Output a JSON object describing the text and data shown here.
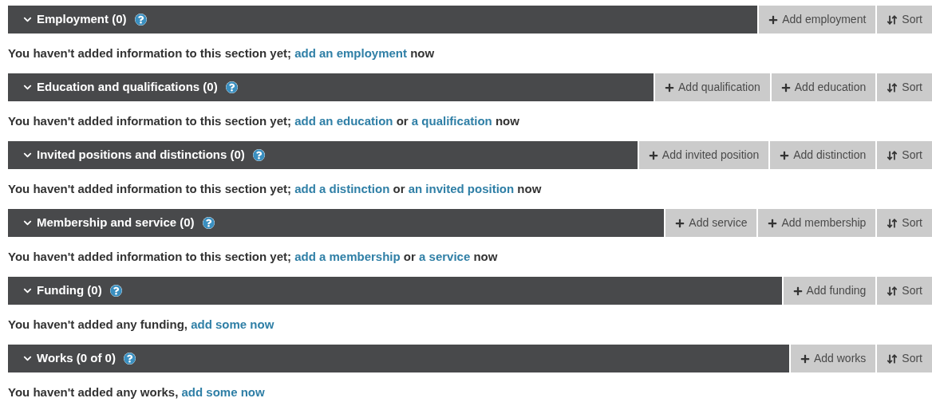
{
  "sections": [
    {
      "title": "Employment (0)",
      "expanded": true,
      "buttons": [
        {
          "kind": "add",
          "label": "Add employment"
        },
        {
          "kind": "sort",
          "label": "Sort"
        }
      ],
      "message": [
        {
          "text": "You haven't added information to this section yet; ",
          "link": false
        },
        {
          "text": "add an employment",
          "link": true
        },
        {
          "text": " now",
          "link": false
        }
      ]
    },
    {
      "title": "Education and qualifications (0)",
      "expanded": true,
      "buttons": [
        {
          "kind": "add",
          "label": "Add qualification"
        },
        {
          "kind": "add",
          "label": "Add education"
        },
        {
          "kind": "sort",
          "label": "Sort"
        }
      ],
      "message": [
        {
          "text": "You haven't added information to this section yet; ",
          "link": false
        },
        {
          "text": "add an education",
          "link": true
        },
        {
          "text": " or ",
          "link": false
        },
        {
          "text": "a qualification",
          "link": true
        },
        {
          "text": " now",
          "link": false
        }
      ]
    },
    {
      "title": "Invited positions and distinctions (0)",
      "expanded": true,
      "buttons": [
        {
          "kind": "add",
          "label": "Add invited position"
        },
        {
          "kind": "add",
          "label": "Add distinction"
        },
        {
          "kind": "sort",
          "label": "Sort"
        }
      ],
      "message": [
        {
          "text": "You haven't added information to this section yet; ",
          "link": false
        },
        {
          "text": "add a distinction",
          "link": true
        },
        {
          "text": " or ",
          "link": false
        },
        {
          "text": "an invited position",
          "link": true
        },
        {
          "text": " now",
          "link": false
        }
      ]
    },
    {
      "title": "Membership and service (0)",
      "expanded": true,
      "buttons": [
        {
          "kind": "add",
          "label": "Add service"
        },
        {
          "kind": "add",
          "label": "Add membership"
        },
        {
          "kind": "sort",
          "label": "Sort"
        }
      ],
      "message": [
        {
          "text": "You haven't added information to this section yet; ",
          "link": false
        },
        {
          "text": "add a membership",
          "link": true
        },
        {
          "text": " or ",
          "link": false
        },
        {
          "text": "a service",
          "link": true
        },
        {
          "text": " now",
          "link": false
        }
      ]
    },
    {
      "title": "Funding (0)",
      "expanded": true,
      "buttons": [
        {
          "kind": "add",
          "label": "Add funding"
        },
        {
          "kind": "sort",
          "label": "Sort"
        }
      ],
      "message": [
        {
          "text": "You haven't added any funding, ",
          "link": false
        },
        {
          "text": "add some now",
          "link": true
        }
      ]
    },
    {
      "title": "Works (0 of 0)",
      "expanded": true,
      "buttons": [
        {
          "kind": "add",
          "label": "Add works"
        },
        {
          "kind": "sort",
          "label": "Sort"
        }
      ],
      "message": [
        {
          "text": "You haven't added any works, ",
          "link": false
        },
        {
          "text": "add some now",
          "link": true
        }
      ]
    }
  ]
}
